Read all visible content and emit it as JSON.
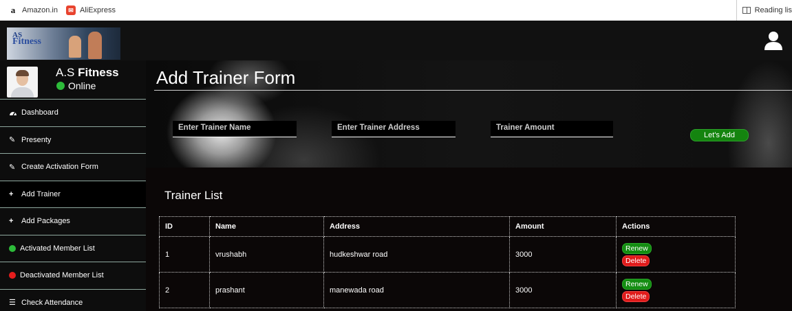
{
  "bookmarks": {
    "items": [
      {
        "label": "Amazon.in",
        "icon": "amazon-icon"
      },
      {
        "label": "AliExpress",
        "icon": "aliexpress-icon"
      }
    ],
    "reading_list_label": "Reading lis"
  },
  "header": {
    "logo_text_top": "AS",
    "logo_text_main": "Fitness",
    "user_icon": "user-icon"
  },
  "sidebar": {
    "brand_prefix": "A.S ",
    "brand_bold": "Fitness",
    "status": "Online",
    "items": [
      {
        "label": "Dashboard",
        "icon": "dashboard-icon"
      },
      {
        "label": "Presenty",
        "icon": "pencil-icon"
      },
      {
        "label": "Create Activation Form",
        "icon": "pencil-icon"
      },
      {
        "label": "Add Trainer",
        "icon": "plus-icon"
      },
      {
        "label": "Add Packages",
        "icon": "plus-icon"
      },
      {
        "label": "Activated Member List",
        "icon": "green-dot-icon"
      },
      {
        "label": "Deactivated Member List",
        "icon": "red-dot-icon"
      },
      {
        "label": "Check Attendance",
        "icon": "list-icon"
      }
    ]
  },
  "form": {
    "title": "Add Trainer Form",
    "name_placeholder": "Enter Trainer Name",
    "address_placeholder": "Enter Trainer Address",
    "amount_placeholder": "Trainer Amount",
    "submit_label": "Let's Add"
  },
  "trainer_list": {
    "title": "Trainer List",
    "columns": [
      "ID",
      "Name",
      "Address",
      "Amount",
      "Actions"
    ],
    "rows": [
      {
        "id": "1",
        "name": "vrushabh",
        "address": "hudkeshwar road",
        "amount": "3000",
        "renew": "Renew",
        "delete": "Delete"
      },
      {
        "id": "2",
        "name": "prashant",
        "address": "manewada road",
        "amount": "3000",
        "renew": "Renew",
        "delete": "Delete"
      }
    ]
  },
  "colors": {
    "accent_green": "#14840f",
    "delete_red": "#e01b1b",
    "online_green": "#2dbb3a"
  }
}
